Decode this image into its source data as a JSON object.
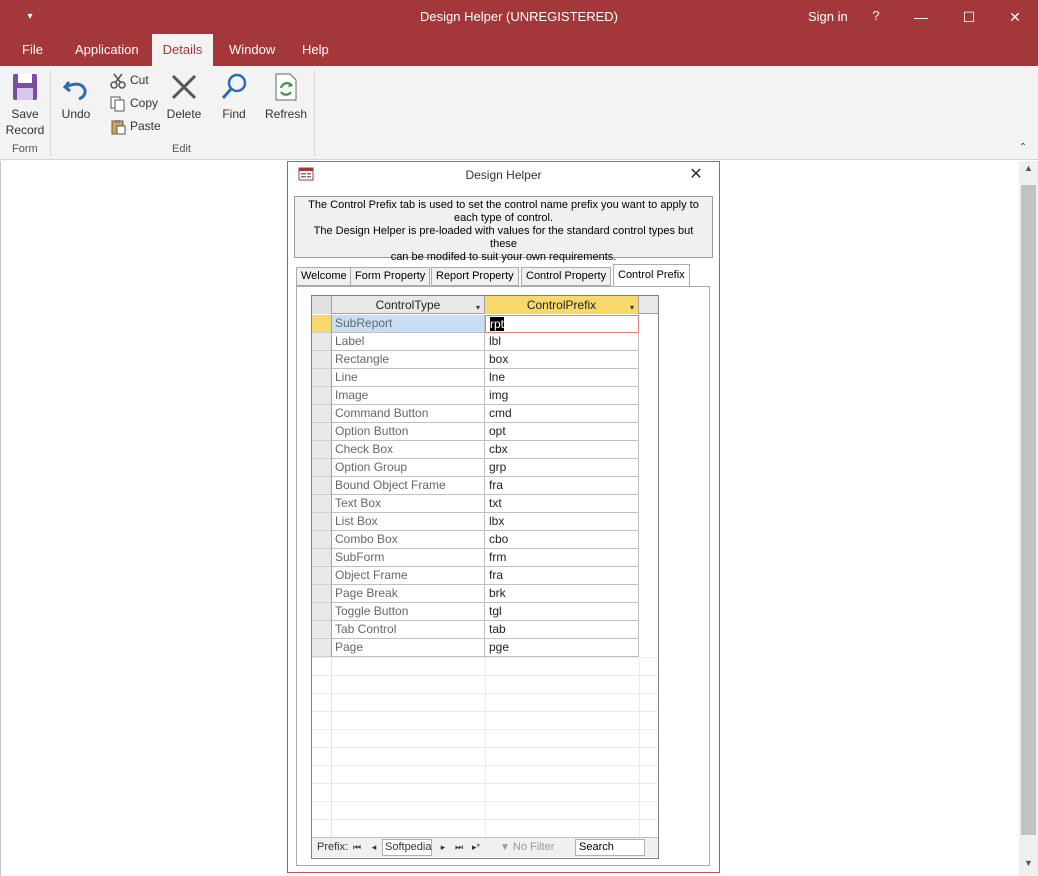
{
  "window": {
    "title": "Design Helper (UNREGISTERED)",
    "sign_in": "Sign in",
    "help": "?",
    "qat_glyph": "▾",
    "min_glyph": "—",
    "max_glyph": "☐",
    "close_glyph": "✕"
  },
  "ribbon_tabs": [
    {
      "label": "File"
    },
    {
      "label": "Application"
    },
    {
      "label": "Details"
    },
    {
      "label": "Window"
    },
    {
      "label": "Help"
    }
  ],
  "active_tab": "Details",
  "ribbon": {
    "save_label_1": "Save",
    "save_label_2": "Record",
    "form_group": "Form",
    "undo_label": "Undo",
    "cut_label": "Cut",
    "copy_label": "Copy",
    "paste_label": "Paste",
    "delete_label": "Delete",
    "find_label": "Find",
    "refresh_label": "Refresh",
    "edit_group": "Edit",
    "collapse_glyph": "⌃"
  },
  "colors": {
    "accent": "#a4373a",
    "header_highlight": "#f7d96b",
    "selection": "#c9def5"
  },
  "dialog": {
    "title": "Design Helper",
    "close_glyph": "✕",
    "info_lines": [
      "The Control Prefix tab is used to set the control name prefix you want to apply to",
      "each type of control.",
      "The Design Helper is pre-loaded with values for the standard control types but these",
      "can be modifed to suit your own requirements."
    ],
    "tabs": [
      {
        "label": "Welcome"
      },
      {
        "label": "Form Property"
      },
      {
        "label": "Report Property"
      },
      {
        "label": "Control Property"
      },
      {
        "label": "Control Prefix"
      }
    ],
    "active_tab": "Control Prefix"
  },
  "grid": {
    "columns": [
      "ControlType",
      "ControlPrefix"
    ],
    "filter_glyph": "▾",
    "rows": [
      {
        "type": "SubReport",
        "prefix": "rpt"
      },
      {
        "type": "Label",
        "prefix": "lbl"
      },
      {
        "type": "Rectangle",
        "prefix": "box"
      },
      {
        "type": "Line",
        "prefix": "lne"
      },
      {
        "type": "Image",
        "prefix": "img"
      },
      {
        "type": "Command Button",
        "prefix": "cmd"
      },
      {
        "type": "Option Button",
        "prefix": "opt"
      },
      {
        "type": "Check Box",
        "prefix": "cbx"
      },
      {
        "type": "Option Group",
        "prefix": "grp"
      },
      {
        "type": "Bound Object Frame",
        "prefix": "fra"
      },
      {
        "type": "Text Box",
        "prefix": "txt"
      },
      {
        "type": "List Box",
        "prefix": "lbx"
      },
      {
        "type": "Combo Box",
        "prefix": "cbo"
      },
      {
        "type": "SubForm",
        "prefix": "frm"
      },
      {
        "type": "Object Frame",
        "prefix": "fra"
      },
      {
        "type": "Page Break",
        "prefix": "brk"
      },
      {
        "type": "Toggle Button",
        "prefix": "tgl"
      },
      {
        "type": "Tab Control",
        "prefix": "tab"
      },
      {
        "type": "Page",
        "prefix": "pge"
      }
    ]
  },
  "navbar": {
    "label": "Prefix:",
    "first": "⏮",
    "prev": "◂",
    "record": "Softpedia",
    "next": "▸",
    "last": "⏭",
    "new": "▸*",
    "filter_icon": "▼",
    "filter": "No Filter",
    "search": "Search"
  },
  "scroll": {
    "up": "▲",
    "down": "▼"
  }
}
